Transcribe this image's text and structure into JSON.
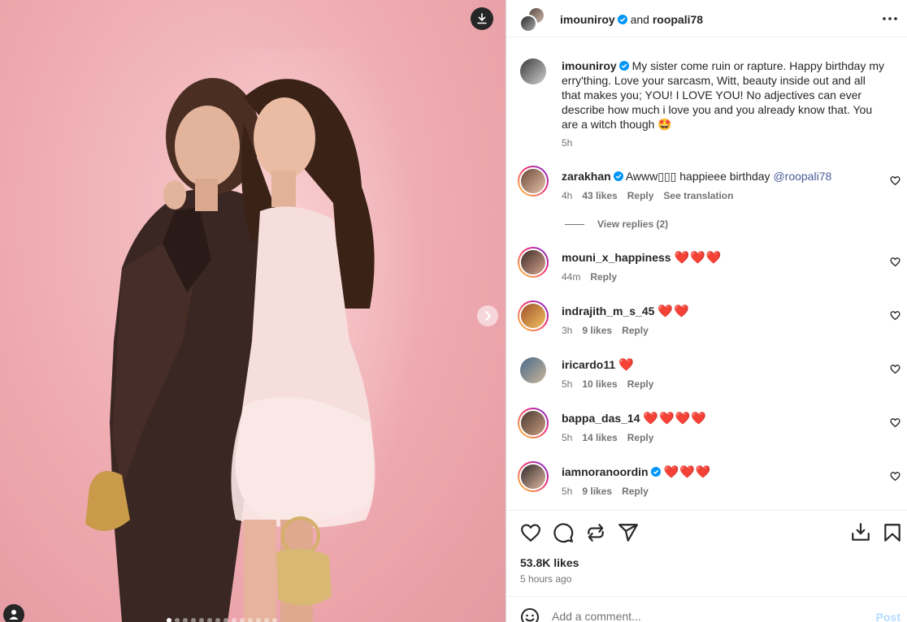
{
  "header": {
    "author": "imouniroy",
    "connector": "and",
    "coauthor": "roopali78",
    "more_icon": "more-horizontal-icon"
  },
  "caption": {
    "username": "imouniroy",
    "text": "My sister come ruin or rapture. Happy birthday my erry'thing. Love your sarcasm, Witt, beauty inside out and all that makes you; YOU! I LOVE YOU! No adjectives can ever describe how much i love you and you already know that. You are a witch though 🤩",
    "time": "5h"
  },
  "comments": [
    {
      "username": "zarakhan",
      "verified": true,
      "text": "Awww▯▯▯ happieee birthday ",
      "mention": "@roopali78",
      "time": "4h",
      "likes": "43 likes",
      "reply": "Reply",
      "translate": "See translation",
      "view_replies": "View replies (2)"
    },
    {
      "username": "mouni_x_happiness",
      "verified": false,
      "text": "❤️❤️❤️",
      "time": "44m",
      "likes": "",
      "reply": "Reply"
    },
    {
      "username": "indrajith_m_s_45",
      "verified": false,
      "text": "❤️❤️",
      "time": "3h",
      "likes": "9 likes",
      "reply": "Reply"
    },
    {
      "username": "iricardo11",
      "verified": false,
      "text": "❤️",
      "time": "5h",
      "likes": "10 likes",
      "reply": "Reply"
    },
    {
      "username": "bappa_das_14",
      "verified": false,
      "text": "❤️❤️❤️❤️",
      "time": "5h",
      "likes": "14 likes",
      "reply": "Reply"
    },
    {
      "username": "iamnoranoordin",
      "verified": true,
      "text": "❤️❤️❤️",
      "time": "5h",
      "likes": "9 likes",
      "reply": "Reply"
    }
  ],
  "stats": {
    "likes": "53.8K likes",
    "posted": "5 hours ago"
  },
  "composer": {
    "placeholder": "Add a comment...",
    "post_label": "Post"
  },
  "carousel": {
    "current": 1,
    "total": 14
  },
  "colors": {
    "verified_blue": "#0095f6",
    "link_blue": "#4a5d9a",
    "heart_red": "#e0102a",
    "post_disabled": "#b3dbff",
    "photo_background": "#eeaab0"
  }
}
